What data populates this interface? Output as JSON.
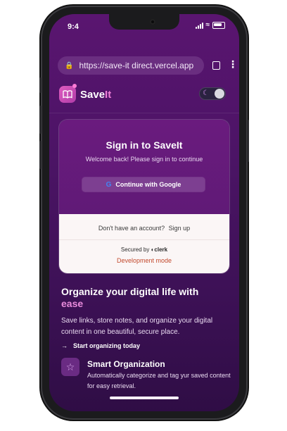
{
  "status_bar": {
    "time": "9:4"
  },
  "browser": {
    "url": "https://save-it direct.vercel.app"
  },
  "app": {
    "brand_prefix": "Save",
    "brand_suffix": "It"
  },
  "signin": {
    "title": "Sign in to SaveIt",
    "subtitle": "Welcome back! Please sign in to continue",
    "google_button": "Continue with Google",
    "no_account_text": "Don't have an account?",
    "signup_link": "Sign up",
    "secured_by": "Secured by",
    "clerk_name": "clerk",
    "dev_mode": "Development mode"
  },
  "hero": {
    "title_line1": "Organize your digital life with",
    "title_accent": "ease",
    "description": "Save links, store notes, and organize your digital content in one beautiful, secure place.",
    "cta": "Start organizing today"
  },
  "feature": {
    "title": "Smart Organization",
    "description": "Automatically categorize and tag yur saved content for easy retrieval.",
    "icon": "star-icon"
  },
  "colors": {
    "accent": "#e98bdc",
    "background": "#4c1466",
    "dev_mode": "#c24a2e"
  }
}
